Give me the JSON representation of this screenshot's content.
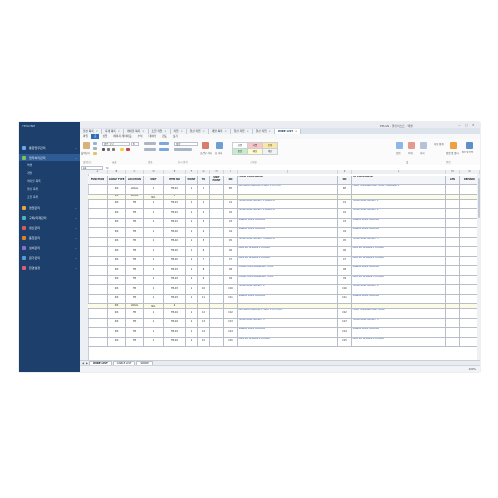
{
  "sidebar": {
    "logo": "YESONE",
    "items": [
      {
        "label": "통합업무관리",
        "color": "#6aa6e8"
      },
      {
        "label": "업무처리관리",
        "color": "#79c25b"
      },
      {
        "label": "영업관리",
        "color": "#e8a53a"
      },
      {
        "label": "구매/자재관리",
        "color": "#4db3b3"
      },
      {
        "label": "생산관리",
        "color": "#d95c5c"
      },
      {
        "label": "품질관리",
        "color": "#e07f2e"
      },
      {
        "label": "설비관리",
        "color": "#8b6fd1"
      },
      {
        "label": "원가관리",
        "color": "#5a9bd6"
      },
      {
        "label": "환경설정",
        "color": "#e05a7a"
      }
    ],
    "subitems": [
      "엑셀",
      "개발",
      "케이블 목록",
      "결선 목록",
      "조립 목록"
    ]
  },
  "window": {
    "title": "EPLAN - 결선리스트 - 엑셀",
    "min": "—",
    "max": "□",
    "close": "✕"
  },
  "tabs": [
    "결선 목록",
    "자재 목록",
    "케이블 목록",
    "조립 작업",
    "작업",
    "결선 작업",
    "개발 목록",
    "결선 작업",
    "결선 작업",
    "WIRE LIST"
  ],
  "active_tab": "WIRE LIST",
  "ribbon": {
    "tabs": [
      "파일",
      "홈",
      "삽입",
      "페이지 레이아웃",
      "수식",
      "데이터",
      "검토",
      "보기"
    ],
    "active": "홈",
    "font_name": "맑은 고딕",
    "font_size": "8",
    "number_format": "일반",
    "groups": [
      "클립보드",
      "글꼴",
      "맞춤",
      "표시 형식",
      "스타일",
      "셀",
      "편집"
    ],
    "styles": [
      {
        "label": "표준",
        "bg": "#ffffff"
      },
      {
        "label": "나쁨",
        "bg": "#f7c6cb"
      },
      {
        "label": "보통",
        "bg": "#fbe7a1"
      },
      {
        "label": "좋음",
        "bg": "#c7eccb"
      },
      {
        "label": "메모",
        "bg": "#fff9cc"
      },
      {
        "label": "계산",
        "bg": "#f2f2f2"
      }
    ],
    "labels": {
      "paste": "붙여넣기",
      "cond": "조건부 서식",
      "table": "표 서식",
      "insert": "삽입",
      "delete": "삭제",
      "format": "서식",
      "sum": "자동 합계",
      "sort": "정렬 및 필터",
      "find": "찾기 및 선택"
    }
  },
  "formula": {
    "cell_ref": "A1",
    "fx": "fx"
  },
  "columns": [
    "A",
    "B",
    "C",
    "D",
    "E",
    "F",
    "G",
    "H",
    "I",
    "J",
    "K",
    "L",
    "M",
    "N",
    "O"
  ],
  "table": {
    "headers": [
      "FUNCTION",
      "CABLE TYPE",
      "LOCATION",
      "UNIT",
      "ITEM NO",
      "POINT",
      "TO",
      "UNIT POINT",
      "NO",
      "FROM COMPONENT",
      "NO",
      "TO COMPONENT",
      "LEN",
      "REMARK"
    ],
    "rows": [
      {
        "type": "data",
        "cells": [
          "",
          "SIS",
          "LOCAL",
          "1",
          "TB-01",
          "1",
          "1",
          "",
          "SH",
          "PLC RACK MODULE 0 SLOT 1 CH 1 DI",
          "SH",
          "FIELD TERMINAL BOX TB-01 TERMINAL 1",
          "",
          ""
        ]
      },
      {
        "type": "sec",
        "cells": [
          "",
          "SIS",
          "LOCAL",
          "SPARE CABLE NO.",
          "3",
          "",
          "",
          "",
          "",
          "",
          "",
          "",
          "",
          ""
        ]
      },
      {
        "type": "data",
        "cells": [
          "",
          "SIS",
          "TB",
          "1",
          "TB-01",
          "1",
          "1",
          "",
          "C1",
          "TELEPHONE SOCKET 1 ROOM A",
          "C1",
          "TELEPHONE SOCKET 1",
          "",
          ""
        ]
      },
      {
        "type": "data",
        "cells": [
          "",
          "SIS",
          "TB",
          "1",
          "TB-01",
          "1",
          "2",
          "",
          "C2",
          "TELEPHONE SOCKET 2 ROOM A",
          "C2",
          "TELEPHONE SOCKET 2",
          "",
          ""
        ]
      },
      {
        "type": "data",
        "cells": [
          "",
          "SIS",
          "TB",
          "1",
          "TB-01",
          "1",
          "3",
          "",
          "C3",
          "SIGNAL LAMP COLUMN",
          "C3",
          "SIGNAL LAMP COLUMN",
          "",
          ""
        ]
      },
      {
        "type": "data",
        "cells": [
          "",
          "SIS",
          "TB",
          "1",
          "TB-02",
          "1",
          "4",
          "",
          "C4",
          "SIGNAL LAMP COLUMN",
          "C4",
          "SIGNAL LAMP COLUMN",
          "",
          ""
        ]
      },
      {
        "type": "data",
        "cells": [
          "",
          "SIS",
          "TB",
          "1",
          "TB-02",
          "1",
          "5",
          "",
          "C5",
          "TELEPHONE SOCKET 3 ROOM B",
          "C5",
          "TELEPHONE SOCKET 3",
          "",
          ""
        ]
      },
      {
        "type": "data",
        "cells": [
          "",
          "SIS",
          "TB",
          "1",
          "TB-02",
          "1",
          "6",
          "",
          "C6",
          "PROFILE SENSOR 1 POWER",
          "C6",
          "PROFILE SENSOR 1 POWER",
          "",
          ""
        ]
      },
      {
        "type": "data",
        "cells": [
          "",
          "SIS",
          "TB",
          "1",
          "TB-02",
          "1",
          "7",
          "",
          "C7",
          "PROFILE SENSOR 2 POWER",
          "C7",
          "PROFILE SENSOR 2 POWER",
          "",
          ""
        ]
      },
      {
        "type": "data",
        "cells": [
          "",
          "SIS",
          "TB",
          "1",
          "TB-03",
          "1",
          "8",
          "",
          "C8",
          "CONVEYOR EMERGENCY STOP",
          "C8",
          "SIGNAL LAMP COLUMN",
          "",
          ""
        ]
      },
      {
        "type": "data",
        "cells": [
          "",
          "SIS",
          "TB",
          "1",
          "TB-03",
          "1",
          "9",
          "",
          "C9",
          "CONVEYOR EMERGENCY STOP",
          "C9",
          "PROFILE SENSOR 3 POWER",
          "",
          ""
        ]
      },
      {
        "type": "data",
        "cells": [
          "",
          "SIS",
          "TB",
          "1",
          "TB-03",
          "1",
          "10",
          "",
          "C10",
          "TELEPHONE SOCKET 4",
          "C10",
          "TELEPHONE SOCKET 4",
          "",
          ""
        ]
      },
      {
        "type": "data",
        "cells": [
          "",
          "SIS",
          "TB",
          "1",
          "TB-03",
          "1",
          "11",
          "",
          "C11",
          "SIGNAL LAMP COLUMN",
          "C11",
          "SIGNAL LAMP COLUMN",
          "",
          ""
        ]
      },
      {
        "type": "sec",
        "cells": [
          "",
          "SIS",
          "LOCAL",
          "SPARE CABLE NO.",
          "4",
          "",
          "",
          "",
          "",
          "",
          "",
          "",
          "",
          ""
        ]
      },
      {
        "type": "data",
        "cells": [
          "",
          "SIS",
          "TB",
          "1",
          "TB-04",
          "1",
          "12",
          "",
          "C12",
          "PLC RACK MODULE 1 SLOT 2 CH 1 DO",
          "C12",
          "FIELD TERMINAL BOX TB-04",
          "",
          ""
        ]
      },
      {
        "type": "data",
        "cells": [
          "",
          "SIS",
          "TB",
          "1",
          "TB-04",
          "1",
          "13",
          "",
          "C13",
          "TELEPHONE SOCKET 5",
          "C13",
          "TELEPHONE SOCKET 5",
          "",
          ""
        ]
      },
      {
        "type": "data",
        "cells": [
          "",
          "SIS",
          "TB",
          "1",
          "TB-04",
          "1",
          "14",
          "",
          "C14",
          "SIGNAL LAMP COLUMN",
          "C14",
          "SIGNAL LAMP COLUMN",
          "",
          ""
        ]
      },
      {
        "type": "data",
        "cells": [
          "",
          "SIS",
          "TB",
          "1",
          "TB-04",
          "1",
          "15",
          "",
          "C15",
          "PROFILE SENSOR 4 POWER",
          "C15",
          "PROFILE SENSOR 4 POWER",
          "",
          ""
        ]
      }
    ]
  },
  "sheets": [
    "WIRE LIST",
    "CABLE LIST",
    "SPARE"
  ],
  "status": {
    "zoom": "100%"
  }
}
